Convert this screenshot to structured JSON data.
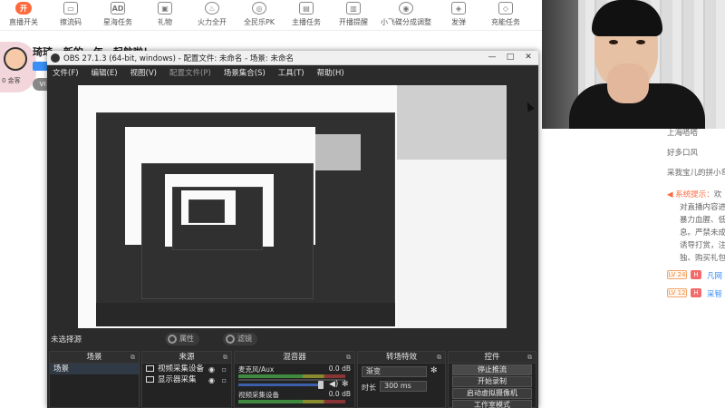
{
  "topbar": {
    "items": [
      {
        "label": "直播开关",
        "icon": "live-toggle-icon",
        "glyph": "开"
      },
      {
        "label": "擦流码",
        "icon": "stream-key-icon",
        "glyph": "▭"
      },
      {
        "label": "星海任务",
        "icon": "ad-task-icon",
        "glyph": "AD"
      },
      {
        "label": "礼物",
        "icon": "gift-icon",
        "glyph": "▣"
      },
      {
        "label": "火力全开",
        "icon": "fire-icon",
        "glyph": "♨"
      },
      {
        "label": "全民乐PK",
        "icon": "pk-icon",
        "glyph": "◎"
      },
      {
        "label": "主播任务",
        "icon": "task-icon",
        "glyph": "▤"
      },
      {
        "label": "开播提醒",
        "icon": "remind-icon",
        "glyph": "▥"
      },
      {
        "label": "小飞碟分成调整",
        "icon": "ufo-icon",
        "glyph": "◉"
      },
      {
        "label": "发弹",
        "icon": "shoot-icon",
        "glyph": "◈"
      },
      {
        "label": "充能任务",
        "icon": "charge-icon",
        "glyph": "◇"
      }
    ]
  },
  "background": {
    "title": "琦琦 · 新的一年，起航啦！",
    "badge": "VI",
    "avatar_tag": "0 金客"
  },
  "chat": {
    "lines": [
      "上海嗒嗒",
      "好多口风",
      "采我宝儿的拼小弯"
    ],
    "system_label": "系统提示：",
    "system_text": "欢",
    "system_body": [
      "对直播内容进",
      "暴力血腥、低",
      "息。严禁未成",
      "诱导打赏，注",
      "独、购买礼包"
    ],
    "users": [
      {
        "level": "LV 24",
        "h": "H",
        "name": "凡网"
      },
      {
        "level": "LV 12",
        "h": "H",
        "name": "采智"
      }
    ]
  },
  "obs": {
    "title": "OBS 27.1.3 (64-bit, windows) - 配置文件: 未命名 - 场景: 未命名",
    "window_buttons": [
      "—",
      "□",
      "✕"
    ],
    "menus": [
      "文件(F)",
      "编辑(E)",
      "视图(V)",
      "配置文件(P)",
      "场景集合(S)",
      "工具(T)",
      "帮助(H)"
    ],
    "no_source_label": "未选择源",
    "properties_label": "属性",
    "filters_label": "滤镜",
    "docks": {
      "scenes": {
        "title": "场景",
        "items": [
          "场景"
        ]
      },
      "sources": {
        "title": "来源",
        "items": [
          "视频采集设备",
          "显示器采集"
        ]
      },
      "mixer": {
        "title": "混音器",
        "channels": [
          {
            "name": "麦克风/Aux",
            "db": "0.0 dB"
          },
          {
            "name": "视频采集设备",
            "db": "0.0 dB"
          }
        ]
      },
      "transitions": {
        "title": "转场特效",
        "type": "渐变",
        "duration_label": "时长",
        "duration": "300 ms"
      },
      "controls": {
        "title": "控件",
        "buttons": [
          "停止推流",
          "开始录制",
          "启动虚拟摄像机",
          "工作室模式"
        ]
      }
    }
  }
}
